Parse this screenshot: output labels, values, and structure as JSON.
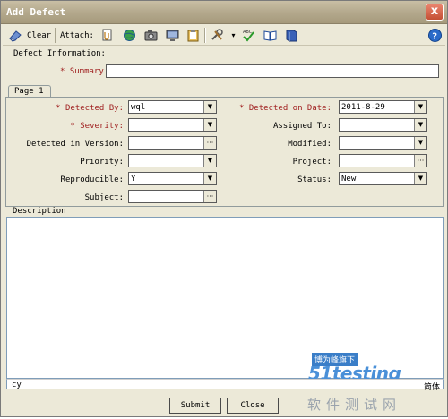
{
  "window": {
    "title": "Add Defect",
    "close_glyph": "x"
  },
  "toolbar": {
    "clear_label": "Clear",
    "attach_label": "Attach:",
    "icons": [
      "eraser-icon",
      "attach-file-icon",
      "attach-url-icon",
      "attach-snapshot-icon",
      "attach-sysinfo-icon",
      "attach-clipboard-icon",
      "tools-icon",
      "spell-check-icon",
      "thesaurus-icon",
      "spelling-options-icon",
      "help-icon"
    ],
    "help_glyph": "?"
  },
  "defect_info_label": "Defect Information:",
  "summary": {
    "label": "* Summary",
    "value": ""
  },
  "tab": {
    "label": "Page 1"
  },
  "fields": {
    "detected_by": {
      "label": "* Detected By:",
      "value": "wql"
    },
    "detected_on_date": {
      "label": "* Detected on Date:",
      "value": "2011-8-29"
    },
    "severity": {
      "label": "* Severity:",
      "value": ""
    },
    "assigned_to": {
      "label": "Assigned To:",
      "value": ""
    },
    "detected_in_version": {
      "label": "Detected in Version:",
      "value": ""
    },
    "modified": {
      "label": "Modified:",
      "value": ""
    },
    "priority": {
      "label": "Priority:",
      "value": ""
    },
    "project": {
      "label": "Project:",
      "value": ""
    },
    "reproducible": {
      "label": "Reproducible:",
      "value": "Y"
    },
    "status": {
      "label": "Status:",
      "value": "New"
    },
    "subject": {
      "label": "Subject:",
      "value": ""
    }
  },
  "description": {
    "label": "Description",
    "value": "",
    "footer_left": "cy",
    "footer_right": "简体"
  },
  "buttons": {
    "submit": "Submit",
    "close": "Close"
  },
  "watermark": {
    "line1": "博为峰旗下",
    "line2": "51testing",
    "line3": "软件测试网"
  },
  "colors": {
    "required": "#a02020",
    "title_bar": "#b4a98d",
    "dialog_bg": "#ece9d8"
  }
}
